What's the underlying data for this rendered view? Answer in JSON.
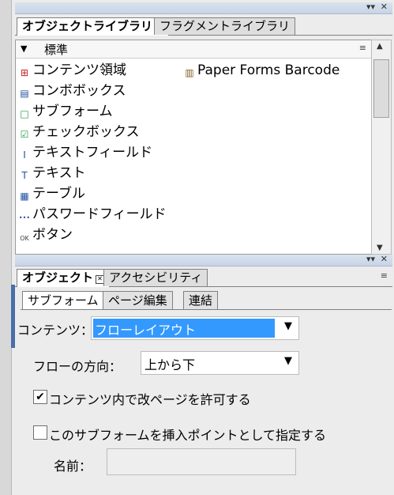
{
  "title_buttons": {
    "more": "▾▾",
    "close": "✕"
  },
  "library_tabs": [
    {
      "label": "オブジェクトライブラリ",
      "active": true
    },
    {
      "label": "フラグメントライブラリ",
      "active": false
    }
  ],
  "library": {
    "group_label": "標準",
    "menu_icon": "≡",
    "items_left": [
      {
        "icon": "content-area-icon",
        "glyph": "⊞",
        "color": "#c02020",
        "label": "コンテンツ領域"
      },
      {
        "icon": "combo-box-icon",
        "glyph": "▤",
        "color": "#2050a0",
        "label": "コンボボックス"
      },
      {
        "icon": "subform-icon",
        "glyph": "□",
        "color": "#20a040",
        "label": "サブフォーム"
      },
      {
        "icon": "checkbox-icon",
        "glyph": "☑",
        "color": "#20a040",
        "label": "チェックボックス"
      },
      {
        "icon": "text-field-icon",
        "glyph": "I",
        "color": "#2050a0",
        "label": "テキストフィールド"
      },
      {
        "icon": "text-icon",
        "glyph": "T",
        "color": "#2050a0",
        "label": "テキスト"
      },
      {
        "icon": "table-icon",
        "glyph": "▦",
        "color": "#2050a0",
        "label": "テーブル"
      },
      {
        "icon": "password-field-icon",
        "glyph": "•••",
        "color": "#2050a0",
        "label": "パスワードフィールド"
      },
      {
        "icon": "button-icon",
        "glyph": "OK",
        "color": "#404040",
        "label": "ボタン"
      }
    ],
    "items_right": [
      {
        "icon": "barcode-icon",
        "glyph": "▥",
        "color": "#806020",
        "label": "Paper Forms Barcode"
      }
    ]
  },
  "object_tabs": [
    {
      "label": "オブジェクト",
      "active": true
    },
    {
      "label": "アクセシビリティ",
      "active": false
    }
  ],
  "object_subtabs": [
    {
      "label": "サブフォーム",
      "active": true
    },
    {
      "label": "ページ編集",
      "active": false
    },
    {
      "label": "連結",
      "active": false
    }
  ],
  "object": {
    "content_label": "コンテンツ：",
    "content_value": "フローレイアウト",
    "flow_label": "フローの方向：",
    "flow_value": "上から下",
    "allow_break_label": "コンテンツ内で改ページを許可する",
    "allow_break_checked": true,
    "insertion_point_label": "このサブフォームを挿入ポイントとして指定する",
    "insertion_point_checked": false,
    "name_label": "名前：",
    "name_value": ""
  },
  "colors": {
    "selection": "#3399ff",
    "titlebar": "#c7d4e6"
  }
}
